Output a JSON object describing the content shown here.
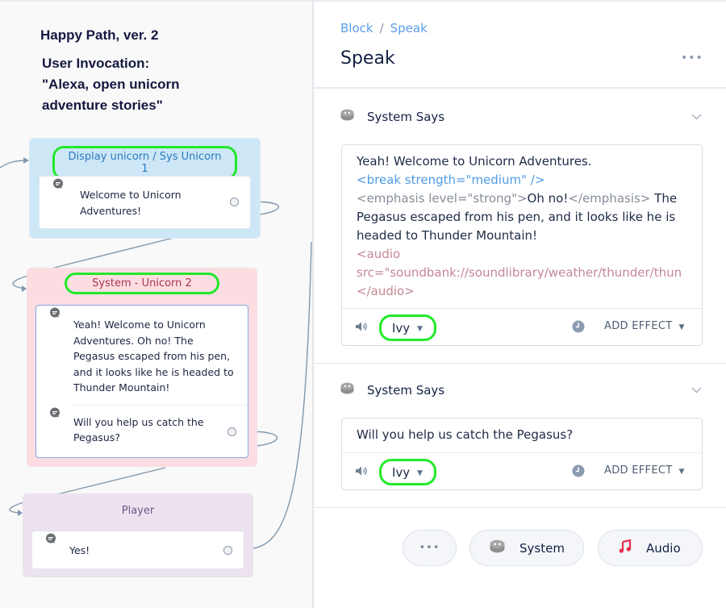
{
  "canvas": {
    "note_title": "Happy Path, ver. 2",
    "note_invocation_lines": [
      "User Invocation:",
      "\"Alexa, open unicorn",
      "adventure stories\""
    ],
    "blocks": [
      {
        "title": "Display unicorn / Sys Unicorn 1",
        "color": "#cde7f6",
        "steps": [
          {
            "icon": "speech-bubble-icon",
            "text": "Welcome to Unicorn Adventures!"
          }
        ]
      },
      {
        "title": "System - Unicorn 2",
        "color": "#fddde2",
        "steps": [
          {
            "icon": "speech-bubble-icon",
            "text": "Yeah! Welcome to Unicorn Adventures. Oh no! The Pegasus escaped from his pen, and it looks like he is headed to Thunder Mountain!"
          },
          {
            "icon": "speech-bubble-icon",
            "text": "Will you help us catch the Pegasus?"
          }
        ]
      },
      {
        "title": "Player",
        "color": "#ede3f0",
        "steps": [
          {
            "icon": "speech-bubble-icon",
            "text": "Yes!"
          }
        ]
      }
    ]
  },
  "panel": {
    "breadcrumb": [
      "Block",
      "Speak"
    ],
    "breadcrumb_sep": "/",
    "title": "Speak",
    "more_label": "•••",
    "sections": [
      {
        "label": "System Says",
        "icon": "system-icon",
        "ssml": {
          "line1": "Yeah! Welcome to Unicorn Adventures.",
          "break_tag": "<break strength=\"medium\" />",
          "emph_open": "<emphasis level=\"strong\">",
          "emph_text": "Oh no!",
          "emph_close": "</emphasis>",
          "after_emph": " The",
          "line4": "Pegasus escaped from his pen, and it looks like he is",
          "line5": "headed to Thunder Mountain!",
          "audio_open": "<audio",
          "audio_src": "src=\"soundbank://soundlibrary/weather/thunder/thun",
          "audio_close": "</audio>"
        },
        "voice": "Ivy",
        "effect_label": "ADD EFFECT"
      },
      {
        "label": "System Says",
        "icon": "system-icon",
        "text": "Will you help us catch the Pegasus?",
        "voice": "Ivy",
        "effect_label": "ADD EFFECT"
      }
    ],
    "actions": {
      "more_label": "•••",
      "system_label": "System",
      "audio_label": "Audio"
    },
    "colors": {
      "breadcrumb": "#5b9ee9",
      "highlight": "#21e92a",
      "audio_icon": "#e8304f"
    }
  }
}
